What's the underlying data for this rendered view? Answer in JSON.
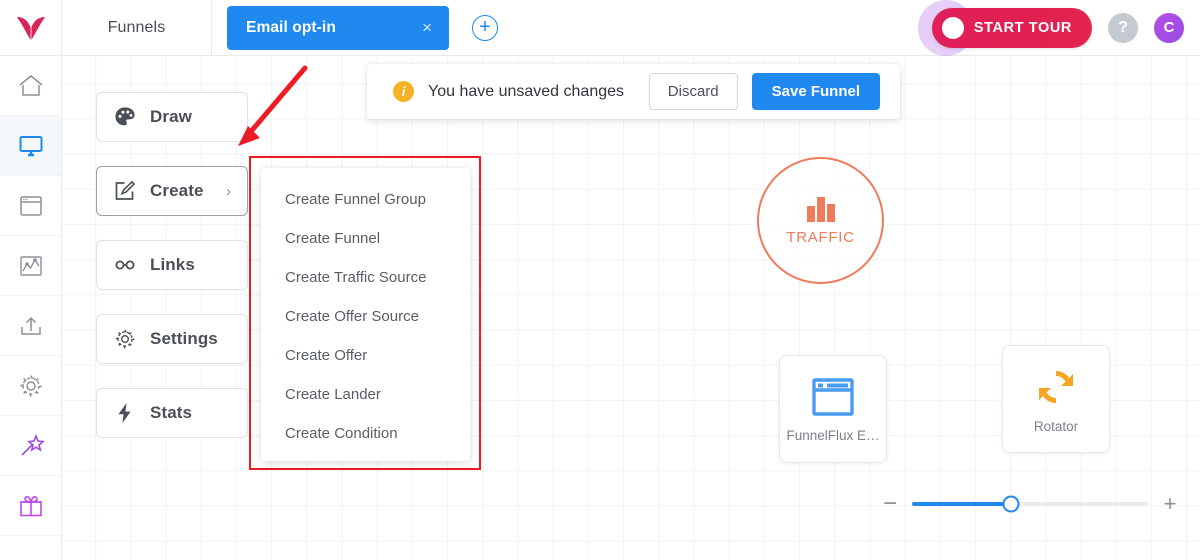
{
  "app": {
    "logo": "funnelflux-logo",
    "nav_label": "Funnels"
  },
  "tabs": [
    {
      "label": "Email opt-in",
      "close": "×",
      "active": true
    }
  ],
  "add_tab_label": "+",
  "topright": {
    "tour_label": "START TOUR",
    "help_label": "?",
    "avatar_initial": "C"
  },
  "rail": {
    "items": [
      {
        "name": "home-icon",
        "active": false
      },
      {
        "name": "monitor-icon",
        "active": true
      },
      {
        "name": "browser-window-icon",
        "active": false
      },
      {
        "name": "chart-icon",
        "active": false
      },
      {
        "name": "upload-icon",
        "active": false
      },
      {
        "name": "gear-icon",
        "active": false
      },
      {
        "name": "magic-wand-icon",
        "active": false
      },
      {
        "name": "gift-icon",
        "active": false
      }
    ]
  },
  "panel": {
    "buttons": [
      {
        "label": "Draw",
        "icon": "palette-icon",
        "chevron": "",
        "active": false
      },
      {
        "label": "Create",
        "icon": "edit-square-icon",
        "chevron": "›",
        "active": true
      },
      {
        "label": "Links",
        "icon": "link-icon",
        "chevron": "",
        "active": false
      },
      {
        "label": "Settings",
        "icon": "gear-icon",
        "chevron": "",
        "active": false
      },
      {
        "label": "Stats",
        "icon": "bolt-icon",
        "chevron": "",
        "active": false
      }
    ]
  },
  "create_menu": {
    "items": [
      {
        "label": "Create Funnel Group"
      },
      {
        "label": "Create Funnel"
      },
      {
        "label": "Create Traffic Source"
      },
      {
        "label": "Create Offer Source"
      },
      {
        "label": "Create Offer"
      },
      {
        "label": "Create Lander"
      },
      {
        "label": "Create Condition"
      }
    ]
  },
  "unsaved_bar": {
    "info_glyph": "i",
    "message": "You have unsaved changes",
    "discard_label": "Discard",
    "save_label": "Save Funnel"
  },
  "canvas_nodes": [
    {
      "id": "traffic",
      "label": "TRAFFIC",
      "icon": "bar-chart-icon",
      "shape": "circle",
      "color": "#ef7b5c"
    },
    {
      "id": "funnelflux",
      "label": "FunnelFlux E…",
      "icon": "browser-window-icon",
      "shape": "card",
      "color": "#4a9cf0"
    },
    {
      "id": "rotator",
      "label": "Rotator",
      "icon": "rotate-arrows-icon",
      "shape": "card",
      "color": "#f5a623"
    }
  ],
  "zoom_control": {
    "minus_label": "−",
    "plus_label": "+",
    "value_percent": 42
  },
  "annotation": {
    "arrow_color": "#ed1c24",
    "highlight_color": "#ed1c24"
  },
  "colors": {
    "accent_blue": "#2089ef",
    "brand_crimson": "#e0205a",
    "warning_amber": "#f5b227",
    "traffic_orange": "#ef7b5c",
    "rotator_amber": "#f5a623",
    "avatar_purple": "#a94ae4"
  }
}
